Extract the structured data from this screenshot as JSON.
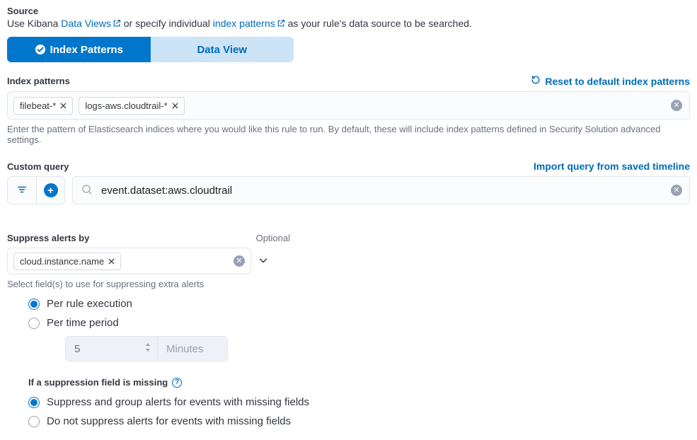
{
  "source": {
    "label": "Source",
    "desc_prefix": "Use Kibana ",
    "link1": "Data Views",
    "desc_mid": " or specify individual ",
    "link2": "index patterns",
    "desc_suffix": " as your rule's data source to be searched."
  },
  "tabs": {
    "index_patterns": "Index Patterns",
    "data_view": "Data View"
  },
  "index_patterns": {
    "label": "Index patterns",
    "reset": "Reset to default index patterns",
    "pills": [
      "filebeat-*",
      "logs-aws.cloudtrail-*"
    ],
    "helper": "Enter the pattern of Elasticsearch indices where you would like this rule to run. By default, these will include index patterns defined in Security Solution advanced settings."
  },
  "custom_query": {
    "label": "Custom query",
    "import_link": "Import query from saved timeline",
    "value": "event.dataset:aws.cloudtrail"
  },
  "suppress": {
    "label": "Suppress alerts by",
    "optional": "Optional",
    "pill": "cloud.instance.name",
    "helper": "Select field(s) to use for suppressing extra alerts",
    "radios": {
      "per_rule": "Per rule execution",
      "per_time": "Per time period"
    },
    "period_value": "5",
    "period_unit": "Minutes",
    "missing_label": "If a suppression field is missing",
    "missing_opts": {
      "suppress": "Suppress and group alerts for events with missing fields",
      "dont": "Do not suppress alerts for events with missing fields"
    }
  }
}
